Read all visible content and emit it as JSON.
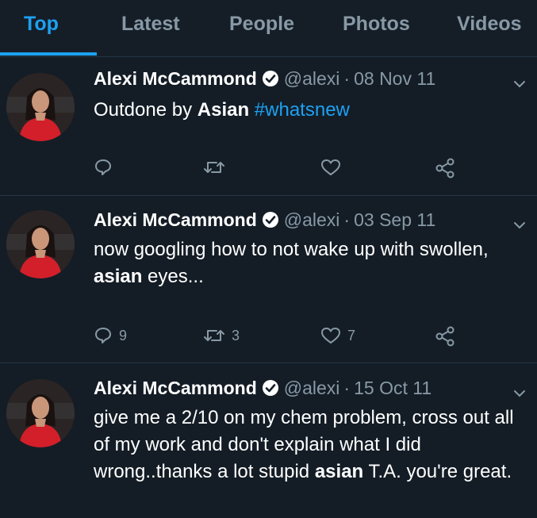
{
  "tabs": [
    {
      "label": "Top",
      "active": true
    },
    {
      "label": "Latest"
    },
    {
      "label": "People"
    },
    {
      "label": "Photos"
    },
    {
      "label": "Videos"
    }
  ],
  "colors": {
    "accent": "#1da1f2",
    "background": "#141d26",
    "muted": "#8899a6"
  },
  "tweets": [
    {
      "name": "Alexi McCammond",
      "handle": "@alexi",
      "sep": "·",
      "date": "08 Nov 11",
      "text_parts": [
        "Outdone by ",
        "Asian",
        " ",
        "#whatsnew"
      ],
      "reply_count": "",
      "retweet_count": "",
      "like_count": ""
    },
    {
      "name": "Alexi McCammond",
      "handle": "@alexi",
      "sep": "·",
      "date": "03 Sep 11",
      "text_parts": [
        "now googling how to not wake up with swollen, ",
        "asian",
        " eyes..."
      ],
      "reply_count": "9",
      "retweet_count": "3",
      "like_count": "7"
    },
    {
      "name": "Alexi McCammond",
      "handle": "@alexi",
      "sep": "·",
      "date": "15 Oct 11",
      "text_parts": [
        "give me a 2/10 on my chem problem, cross out all of my work and don't explain what I did wrong..thanks a lot stupid ",
        "asian",
        " T.A. you're great."
      ]
    }
  ],
  "icons": [
    "verified-icon",
    "chevron-down-icon",
    "reply-icon",
    "retweet-icon",
    "like-icon",
    "share-icon"
  ]
}
